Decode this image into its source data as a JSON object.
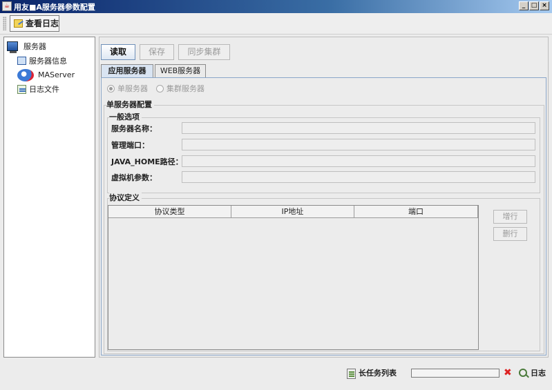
{
  "window": {
    "title": "用友■A服务器参数配置",
    "app_icon": "java-icon",
    "controls": {
      "minimize": "_",
      "maximize": "□",
      "close": "×"
    }
  },
  "toolbar": {
    "view_log_label": "查看日志",
    "view_log_icon": "log-viewer-icon"
  },
  "tree": {
    "root": {
      "label": "服务器",
      "icon": "server-icon"
    },
    "children": [
      {
        "label": "服务器信息",
        "icon": "monitor-icon"
      },
      {
        "label": "MAServer",
        "icon": "ma-server-icon"
      },
      {
        "label": "日志文件",
        "icon": "log-file-icon"
      }
    ]
  },
  "actions": {
    "read_label": "读取",
    "save_label": "保存",
    "sync_label": "同步集群"
  },
  "tabs": [
    {
      "label": "应用服务器",
      "active": true
    },
    {
      "label": "WEB服务器",
      "active": false
    }
  ],
  "mode": {
    "options": [
      {
        "label": "单服务器",
        "selected": true
      },
      {
        "label": "集群服务器",
        "selected": false
      }
    ]
  },
  "single_server_config": {
    "section_title": "单服务器配置",
    "general": {
      "title": "一般选项",
      "fields": [
        {
          "label": "服务器名称：",
          "value": ""
        },
        {
          "label": "管理端口：",
          "value": ""
        },
        {
          "label": "JAVA_HOME路径：",
          "value": ""
        },
        {
          "label": "虚拟机参数：",
          "value": ""
        }
      ]
    },
    "protocol": {
      "title": "协议定义",
      "columns": [
        "协议类型",
        "IP地址",
        "端口"
      ],
      "rows": [],
      "add_row_label": "增行",
      "delete_row_label": "删行"
    }
  },
  "statusbar": {
    "tasks_label": "长任务列表",
    "tasks_icon": "task-list-icon",
    "progress": 0,
    "log_label": "日志",
    "colors": {
      "close": "#dd2222",
      "accent": "#7fa7d9"
    }
  }
}
